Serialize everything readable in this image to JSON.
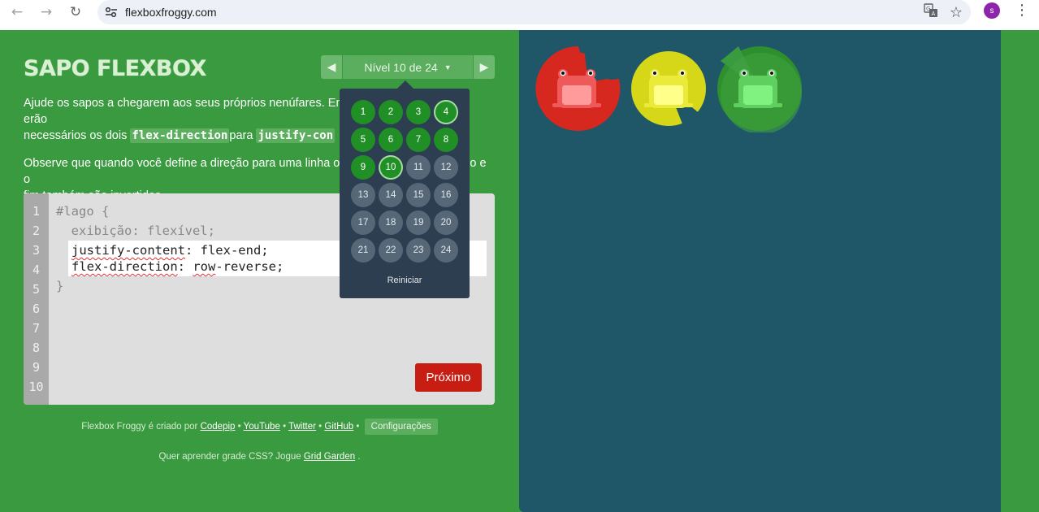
{
  "browser": {
    "url": "flexboxfroggy.com",
    "profile_initial": "s"
  },
  "header": {
    "logo": "SAPO FLEXBOX",
    "level_label": "Nível 10 de 24"
  },
  "instructions": {
    "p1_start": "Ajude os sapos a chegarem aos seus próprios nenúfares. Emb",
    "p1_end": "erão",
    "p1_line2_start": "necessários os dois",
    "code1": "flex-direction",
    "p1_para": "para",
    "code2": "justify-con",
    "p2_start": "Observe que quando você define a direção para uma linha ou",
    "p2_end": "o e o",
    "p2_line2": "fim também são invertidos."
  },
  "editor": {
    "line_numbers": [
      "1",
      "2",
      "3",
      "4",
      "5",
      "6",
      "7",
      "8",
      "9",
      "10"
    ],
    "line1": "#lago {",
    "line2": "  exibição: flexível;",
    "input_prop1": "justify-content",
    "input_rest1": ": flex-end;",
    "input_prop2": "flex-direction",
    "input_rest2a": ": ",
    "input_val2": "row",
    "input_rest2b": "-reverse;",
    "line5": "}",
    "next_label": "Próximo"
  },
  "footer": {
    "credit_prefix": "Flexbox Froggy é criado por",
    "links": [
      "Codepip",
      "YouTube",
      "Twitter",
      "GitHub"
    ],
    "separator": "•",
    "settings_label": "Configurações",
    "grid_prefix": "Quer aprender grade CSS? Jogue",
    "grid_link": "Grid Garden",
    "grid_suffix": "."
  },
  "level_popup": {
    "levels": [
      {
        "n": "1",
        "state": "done"
      },
      {
        "n": "2",
        "state": "done"
      },
      {
        "n": "3",
        "state": "done"
      },
      {
        "n": "4",
        "state": "done-ring"
      },
      {
        "n": "5",
        "state": "done"
      },
      {
        "n": "6",
        "state": "done"
      },
      {
        "n": "7",
        "state": "done"
      },
      {
        "n": "8",
        "state": "done"
      },
      {
        "n": "9",
        "state": "done"
      },
      {
        "n": "10",
        "state": "current"
      },
      {
        "n": "11",
        "state": "todo"
      },
      {
        "n": "12",
        "state": "todo"
      },
      {
        "n": "13",
        "state": "todo"
      },
      {
        "n": "14",
        "state": "todo"
      },
      {
        "n": "15",
        "state": "todo"
      },
      {
        "n": "16",
        "state": "todo"
      },
      {
        "n": "17",
        "state": "todo"
      },
      {
        "n": "18",
        "state": "todo"
      },
      {
        "n": "19",
        "state": "todo"
      },
      {
        "n": "20",
        "state": "todo"
      },
      {
        "n": "21",
        "state": "todo"
      },
      {
        "n": "22",
        "state": "todo"
      },
      {
        "n": "23",
        "state": "todo"
      },
      {
        "n": "24",
        "state": "todo"
      }
    ],
    "reset_label": "Reiniciar"
  },
  "pond": {
    "lilypads": [
      "red",
      "yellow",
      "green"
    ],
    "colors": {
      "red": "#d6281f",
      "yellow": "#d7d71a",
      "green": "#2e8f2e"
    }
  }
}
